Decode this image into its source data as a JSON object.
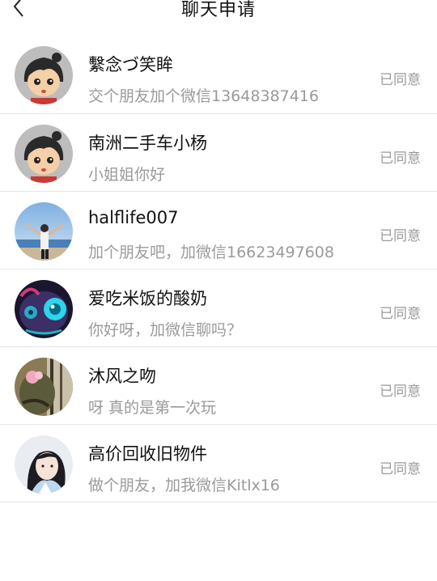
{
  "header": {
    "title": "聊天申请",
    "back_icon": "chevron-left-icon"
  },
  "requests": [
    {
      "name": "繫念づ笑眸",
      "message": "交个朋友加个微信13648387416",
      "status": "已同意",
      "avatar": "cartoon-boy"
    },
    {
      "name": "南洲二手车小杨",
      "message": "小姐姐你好",
      "status": "已同意",
      "avatar": "cartoon-boy"
    },
    {
      "name": "halflife007",
      "message": "加个朋友吧，加微信16623497608",
      "status": "已同意",
      "avatar": "beach-photo"
    },
    {
      "name": "爱吃米饭的酸奶",
      "message": "你好呀，加微信聊吗？",
      "status": "已同意",
      "avatar": "blue-creature"
    },
    {
      "name": "沐风之吻",
      "message": "呀  真的是第一次玩",
      "status": "已同意",
      "avatar": "flower-photo"
    },
    {
      "name": "高价回收旧物件",
      "message": "做个朋友，加我微信Kitlx16",
      "status": "已同意",
      "avatar": "anime-portrait"
    }
  ],
  "colors": {
    "text_primary": "#111111",
    "text_secondary": "#9a9a9a",
    "divider": "#e6e6e6"
  }
}
